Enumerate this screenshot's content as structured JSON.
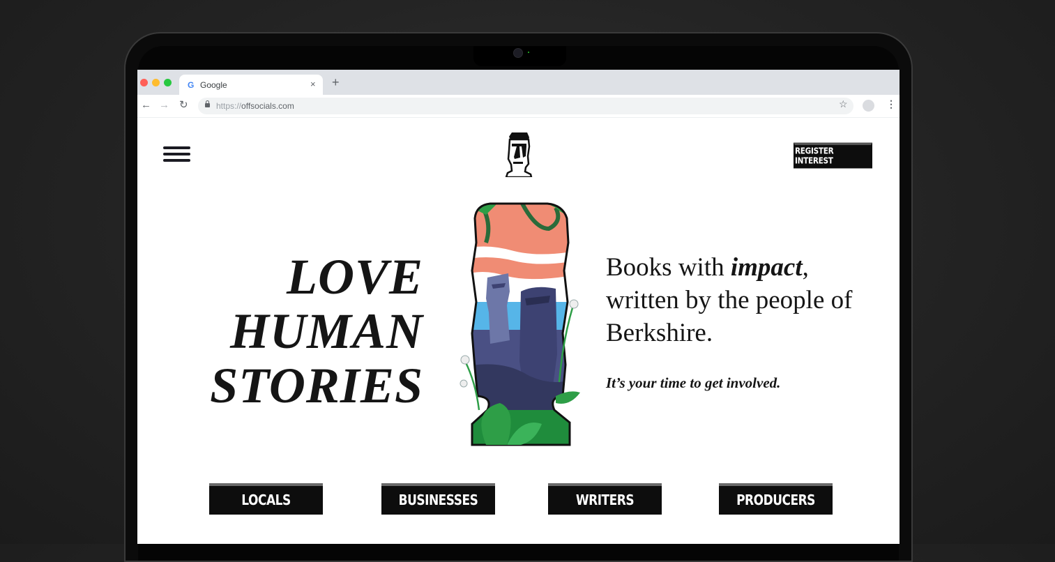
{
  "browser": {
    "tab_title": "Google",
    "tab_favicon": "G",
    "tab_close": "×",
    "new_tab": "+",
    "url_prefix": "https://",
    "url_domain": "offsocials.com",
    "icons": [
      "back-arrow-icon",
      "forward-arrow-icon",
      "reload-icon",
      "lock-icon",
      "star-icon",
      "profile-icon",
      "kebab-menu-icon"
    ],
    "traffic_light_colors": [
      "#ff5f57",
      "#febc2e",
      "#28c840"
    ]
  },
  "site": {
    "register_label": "REGISTER INTEREST",
    "headline": [
      "LOVE",
      "HUMAN",
      "STORIES"
    ],
    "tagline": {
      "part1": "Books with ",
      "emphasis": "impact",
      "part2": ", written by the people of Berkshire."
    },
    "subtagline": "It’s your time to get involved.",
    "categories": [
      "LOCALS",
      "BUSINESSES",
      "WRITERS",
      "PRODUCERS"
    ]
  },
  "colors": {
    "brand_dark": "#0d0d0d",
    "sky_salmon": "#f08c74",
    "sea_blue": "#56b5e8",
    "statue_navy": "#3d4272",
    "leaf_green": "#2e9e47"
  }
}
